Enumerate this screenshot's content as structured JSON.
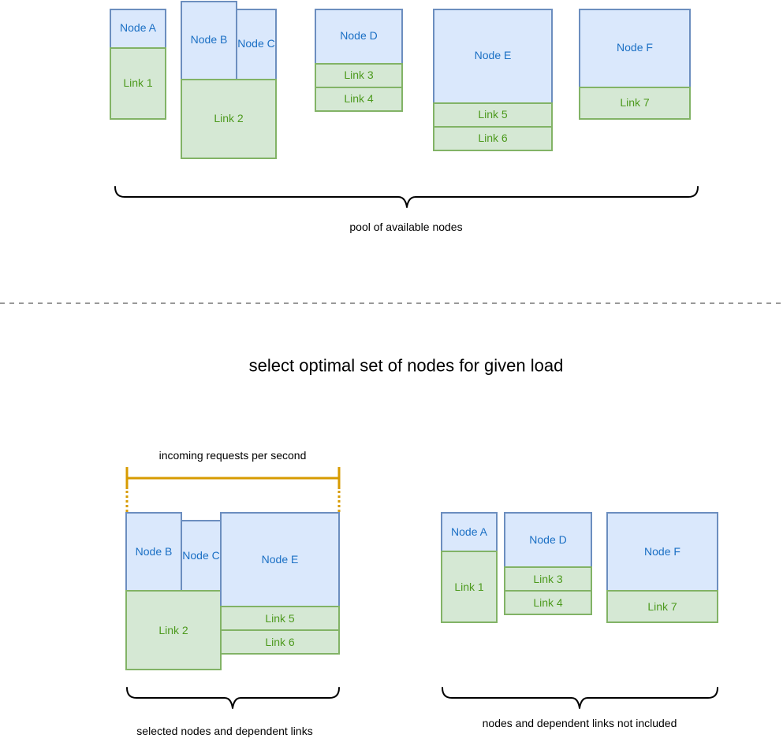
{
  "top": {
    "node_a": "Node A",
    "link_1": "Link 1",
    "node_b": "Node B",
    "node_c": "Node C",
    "link_2": "Link 2",
    "node_d": "Node D",
    "link_3": "Link 3",
    "link_4": "Link 4",
    "node_e": "Node E",
    "link_5": "Link 5",
    "link_6": "Link 6",
    "node_f": "Node F",
    "link_7": "Link 7",
    "pool_caption": "pool of available nodes"
  },
  "heading": "select optimal set of nodes for given load",
  "selected": {
    "load_label": "incoming requests per second",
    "node_b": "Node B",
    "node_c": "Node C",
    "node_e": "Node E",
    "link_2": "Link 2",
    "link_5": "Link 5",
    "link_6": "Link 6",
    "caption": "selected nodes and dependent links"
  },
  "excluded": {
    "node_a": "Node A",
    "link_1": "Link 1",
    "node_d": "Node D",
    "link_3": "Link 3",
    "link_4": "Link 4",
    "node_f": "Node F",
    "link_7": "Link 7",
    "caption": "nodes and dependent links not included"
  }
}
